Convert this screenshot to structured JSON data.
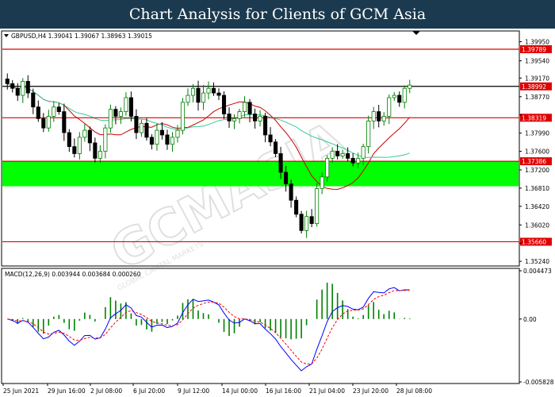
{
  "header": {
    "title": "Chart Analysis for Clients of GCM Asia"
  },
  "chart_data": {
    "type": "candlestick",
    "symbol_info": "GBPUSD,H4  1.39041 1.39067 1.38963 1.39015",
    "price_axis": {
      "ylim": [
        1.3514,
        1.4018
      ],
      "ticks": [
        1.3995,
        1.3954,
        1.3917,
        1.3877,
        1.3838,
        1.3799,
        1.376,
        1.372,
        1.3681,
        1.3642,
        1.3602,
        1.3563,
        1.3524
      ],
      "tick_labels": [
        "1.39950",
        "1.39540",
        "1.39170",
        "1.38770",
        "",
        "1.37990",
        "1.37600",
        "1.37200",
        "1.36810",
        "1.36420",
        "1.36020",
        "",
        "1.35240"
      ]
    },
    "x_labels": [
      "25 Jun 2021",
      "29 Jun 16:00",
      "2 Jul 08:00",
      "6 Jul 20:00",
      "9 Jul 12:00",
      "14 Jul 00:00",
      "16 Jul 16:00",
      "21 Jul 04:00",
      "23 Jul 20:00",
      "28 Jul 08:00"
    ],
    "resistance_support_levels": [
      {
        "value": 1.39789,
        "label": "1.39789"
      },
      {
        "value": 1.38992,
        "label": "1.38992"
      },
      {
        "value": 1.38319,
        "label": "1.38319"
      },
      {
        "value": 1.37386,
        "label": "1.37386"
      },
      {
        "value": 1.3566,
        "label": "1.35660"
      }
    ],
    "zone": {
      "from": 1.3685,
      "to": 1.3738,
      "color": "#00ff00"
    },
    "close_series": [
      1.3905,
      1.3895,
      1.388,
      1.391,
      1.3885,
      1.3855,
      1.383,
      1.381,
      1.3835,
      1.3855,
      1.3845,
      1.38,
      1.377,
      1.3755,
      1.379,
      1.3805,
      1.3778,
      1.3745,
      1.376,
      1.381,
      1.385,
      1.3835,
      1.3845,
      1.3875,
      1.3835,
      1.38,
      1.382,
      1.379,
      1.3775,
      1.3805,
      1.3795,
      1.3775,
      1.379,
      1.3805,
      1.3865,
      1.388,
      1.3895,
      1.3865,
      1.3885,
      1.3895,
      1.3885,
      1.388,
      1.384,
      1.3825,
      1.383,
      1.3845,
      1.3865,
      1.384,
      1.3825,
      1.3835,
      1.3795,
      1.378,
      1.3755,
      1.3715,
      1.369,
      1.3655,
      1.3625,
      1.359,
      1.362,
      1.3605,
      1.368,
      1.3705,
      1.3745,
      1.376,
      1.375,
      1.3755,
      1.3745,
      1.3735,
      1.3745,
      1.377,
      1.3825,
      1.3845,
      1.3825,
      1.3835,
      1.3875,
      1.388,
      1.3865,
      1.3895,
      1.3902
    ],
    "candle_colors": {
      "bull": "#008000",
      "bear": "#000000"
    },
    "moving_averages": [
      {
        "color": "#cc0000"
      },
      {
        "color": "#33cc99"
      }
    ],
    "macd": {
      "label": "MACD(12,26,9) 0.003944 0.003684 0.000260",
      "ylim": [
        -0.005828,
        0.004473
      ],
      "tick_labels": [
        "0.004473",
        "0.00",
        "-0.005828"
      ],
      "macd_color": "#0000ff",
      "signal_color": "#ff0000",
      "histogram_color": "#008000"
    },
    "watermark": {
      "main": "GCMASIA",
      "sub": "GLOBAL CAPITAL MARKETS"
    }
  }
}
